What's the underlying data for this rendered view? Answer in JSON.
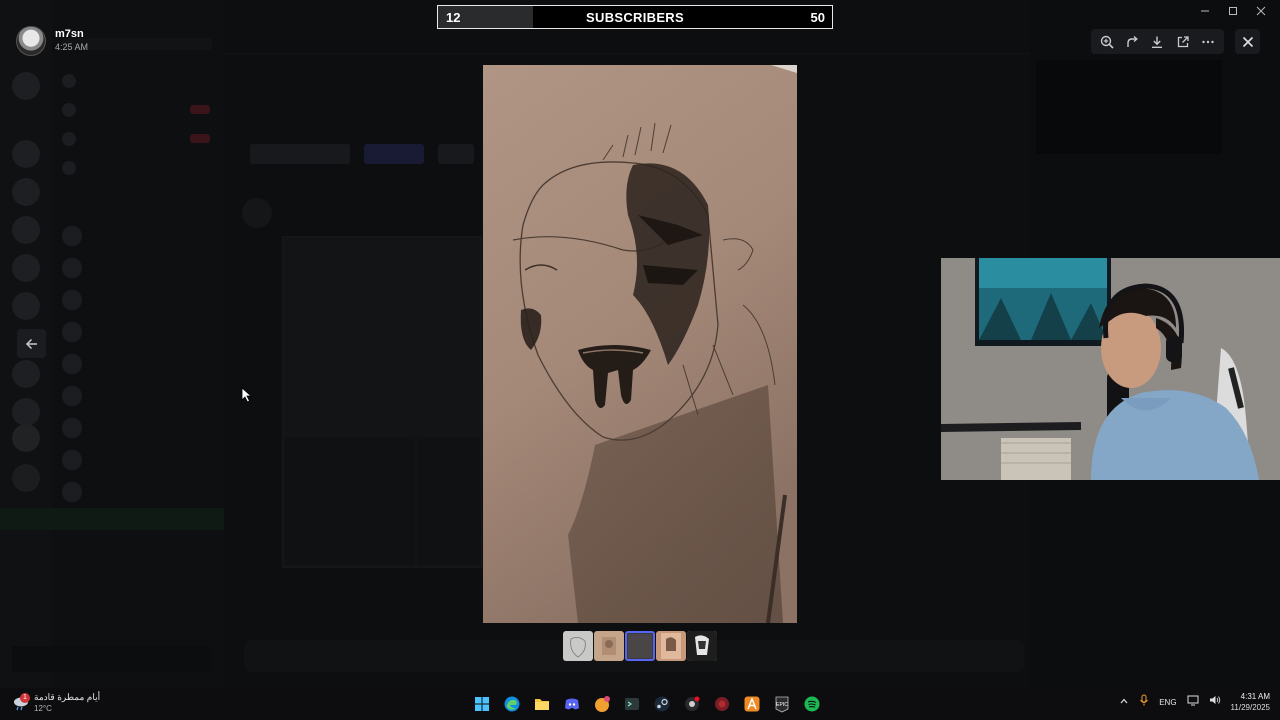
{
  "account": {
    "name": "m7sn",
    "time": "4:25 AM"
  },
  "subscribers": {
    "current": "12",
    "label": "SUBSCRIBERS",
    "goal": "50",
    "progress_fraction": 0.24
  },
  "viewer": {
    "tools": [
      "zoom-in-icon",
      "rotate-icon",
      "download-icon",
      "open-external-icon",
      "more-icon"
    ],
    "close": "close-icon",
    "thumbnail_count": 5,
    "selected_thumbnail": 2
  },
  "taskbar": {
    "weather_text": "أيام ممطرة قادمة",
    "weather_temp": "12°C",
    "weather_badge": "1",
    "language": "ENG",
    "time": "4:31 AM",
    "date": "11/29/2025",
    "apps": [
      "windows-start",
      "edge",
      "file-explorer",
      "discord",
      "app-orange",
      "app-terminal",
      "steam",
      "app-record",
      "app-red",
      "app-a",
      "epic-games",
      "spotify"
    ]
  },
  "colors": {
    "accent": "#5865f2",
    "spotify": "#1db954",
    "edge": "#0f8fe0"
  }
}
